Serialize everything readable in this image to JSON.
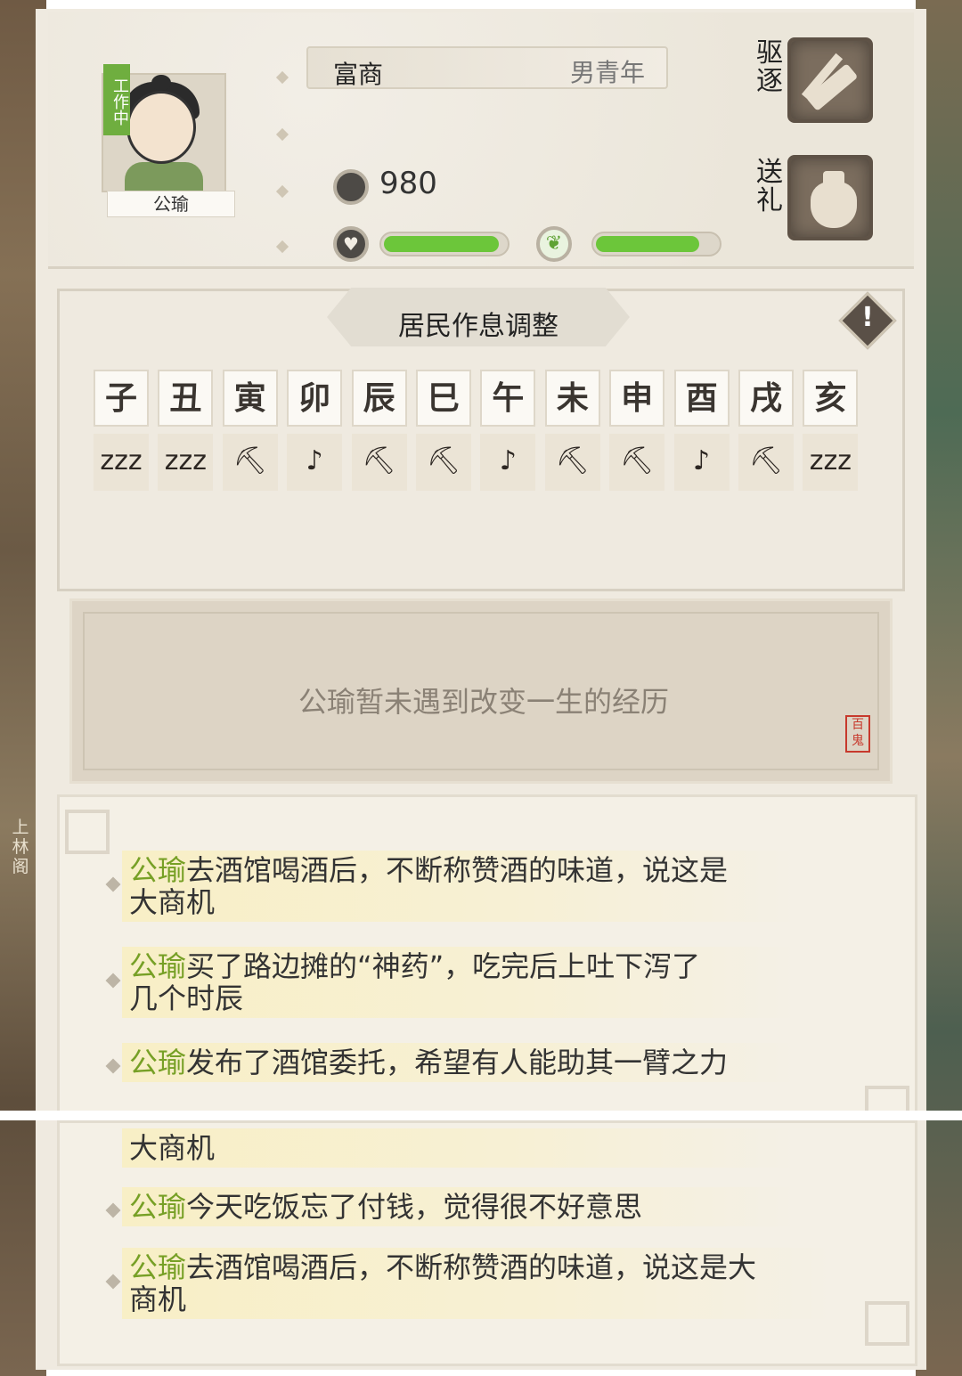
{
  "side": {
    "location_tag": "上林阁"
  },
  "resident": {
    "status_tag": "工作中",
    "name": "公瑜",
    "title": "富商",
    "age_gender": "男青年",
    "coins": "980",
    "health_fill": 0.95,
    "mood_fill": 0.85
  },
  "actions": {
    "expel": "驱逐",
    "gift": "送礼"
  },
  "schedule": {
    "title": "居民作息调整",
    "hours": [
      "子",
      "丑",
      "寅",
      "卯",
      "辰",
      "巳",
      "午",
      "未",
      "申",
      "酉",
      "戌",
      "亥"
    ],
    "activities": [
      "zzz",
      "zzz",
      "⛏",
      "♪",
      "⛏",
      "⛏",
      "♪",
      "⛏",
      "⛏",
      "♪",
      "⛏",
      "zzz"
    ]
  },
  "experience": {
    "text": "公瑜暂未遇到改变一生的经历",
    "seal": "百鬼"
  },
  "log": {
    "items_top": [
      {
        "who": "公瑜",
        "text": "去酒馆喝酒后，不断称赞酒的味道，说这是",
        "text2": "大商机"
      },
      {
        "who": "公瑜",
        "text": "买了路边摊的“神药”，吃完后上吐下泻了",
        "text2": "几个时辰"
      },
      {
        "who": "公瑜",
        "text": "发布了酒馆委托，希望有人能助其一臂之力",
        "text2": ""
      }
    ],
    "items_bottom": [
      {
        "who": "",
        "text": "大商机",
        "text2": ""
      },
      {
        "who": "公瑜",
        "text": "今天吃饭忘了付钱，觉得很不好意思",
        "text2": ""
      },
      {
        "who": "公瑜",
        "text": "去酒馆喝酒后，不断称赞酒的味道，说这是大",
        "text2": "商机"
      }
    ]
  }
}
